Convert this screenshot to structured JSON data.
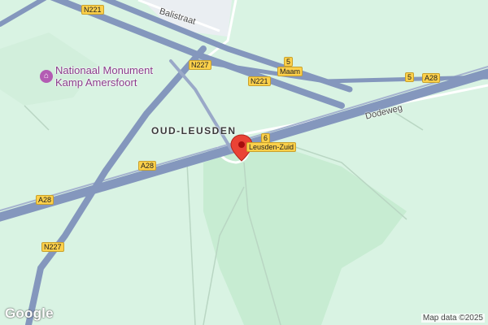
{
  "map": {
    "colors": {
      "land": "#d9f3e3",
      "park": "#c7ecd2",
      "highway": "#8497bd",
      "highway_edge": "#6f83ab",
      "minor_road": "#ffffff",
      "path": "#b9d6c3",
      "shield_bg": "#fcd04a",
      "marker": "#ea4335"
    },
    "labels": {
      "place": "OUD-LEUSDEN",
      "poi_line1": "Nationaal Monument",
      "poi_line2": "Kamp Amersfoort",
      "street_balistraat": "Balistraat",
      "street_dodeweg": "Dodeweg"
    },
    "shields": {
      "n221_top": "N221",
      "n227_top": "N227",
      "n221_mid": "N221",
      "exit5": "5",
      "exit5_right": "5",
      "a28_right": "A28",
      "exit6": "6",
      "a28_mid": "A28",
      "a28_left": "A28",
      "n227_bottom": "N227"
    },
    "exits": {
      "maam": "Maam",
      "leusden_zuid": "Leusden-Zuid"
    },
    "icons": {
      "poi": "monument-icon",
      "marker": "location-pin-icon"
    },
    "attribution": {
      "logo": "Google",
      "map_data": "Map data ©2025"
    }
  }
}
